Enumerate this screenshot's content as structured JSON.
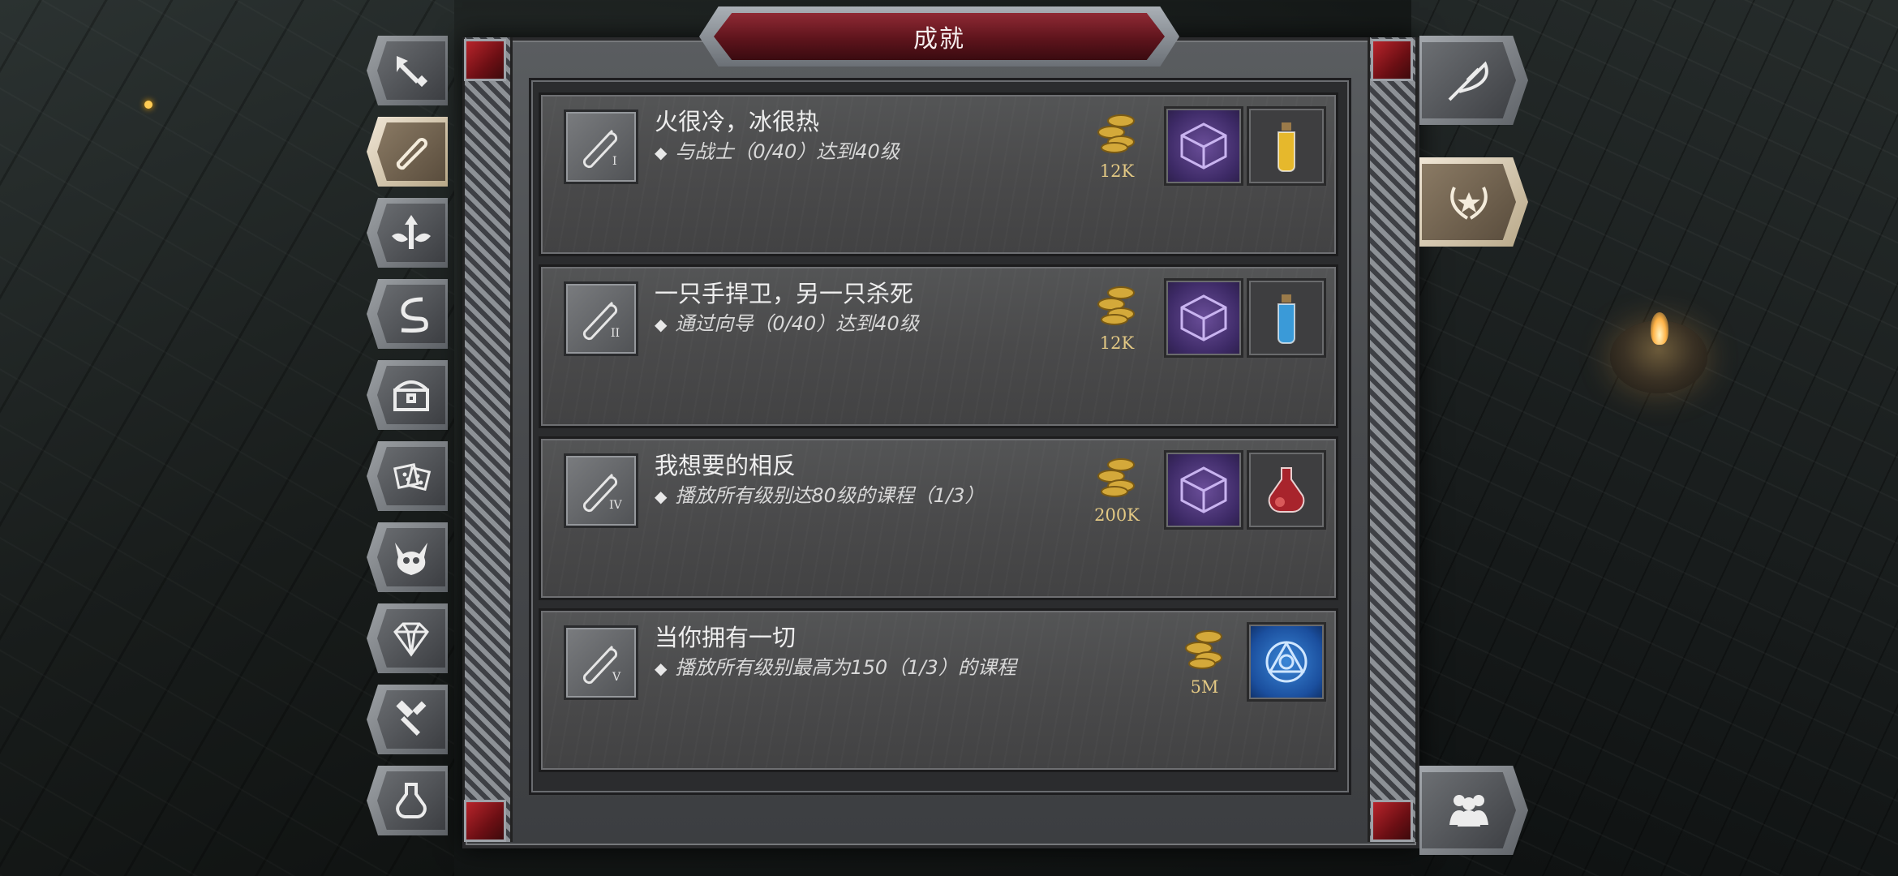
{
  "title": "成就",
  "left_tabs": [
    {
      "icon": "broken-sword-icon",
      "active": false
    },
    {
      "icon": "scroll-icon",
      "active": true
    },
    {
      "icon": "winged-arrow-icon",
      "active": false
    },
    {
      "icon": "serpent-icon",
      "active": false
    },
    {
      "icon": "treasure-chest-icon",
      "active": false
    },
    {
      "icon": "dice-icon",
      "active": false
    },
    {
      "icon": "demon-skull-icon",
      "active": false
    },
    {
      "icon": "gem-icon",
      "active": false
    },
    {
      "icon": "hammer-icon",
      "active": false
    },
    {
      "icon": "potion-icon",
      "active": false
    }
  ],
  "right_tabs": [
    {
      "icon": "quill-icon",
      "active": false
    },
    {
      "icon": "laurel-star-icon",
      "active": true
    },
    {
      "icon": "party-icon",
      "active": false
    }
  ],
  "achievements": [
    {
      "title": "火很冷，冰很热",
      "desc": "与战士（0/40）达到40级",
      "gold": "12K",
      "rewards": [
        "purple-cube-icon",
        "yellow-potion-icon"
      ]
    },
    {
      "title": "一只手捍卫，另一只杀死",
      "desc": "通过向导（0/40）达到40级",
      "gold": "12K",
      "rewards": [
        "purple-cube-icon",
        "blue-potion-icon"
      ]
    },
    {
      "title": "我想要的相反",
      "desc": "播放所有级别达80级的课程（1/3）",
      "gold": "200K",
      "rewards": [
        "purple-cube-icon",
        "red-flask-icon"
      ]
    },
    {
      "title": "当你拥有一切",
      "desc": "播放所有级别最高为150（1/3）的课程",
      "gold": "5M",
      "rewards": [
        "blue-rune-icon"
      ]
    }
  ],
  "colors": {
    "gold": "#e2c884",
    "title_red": "#8f2a34",
    "active_tab": "#f0e6d6"
  }
}
